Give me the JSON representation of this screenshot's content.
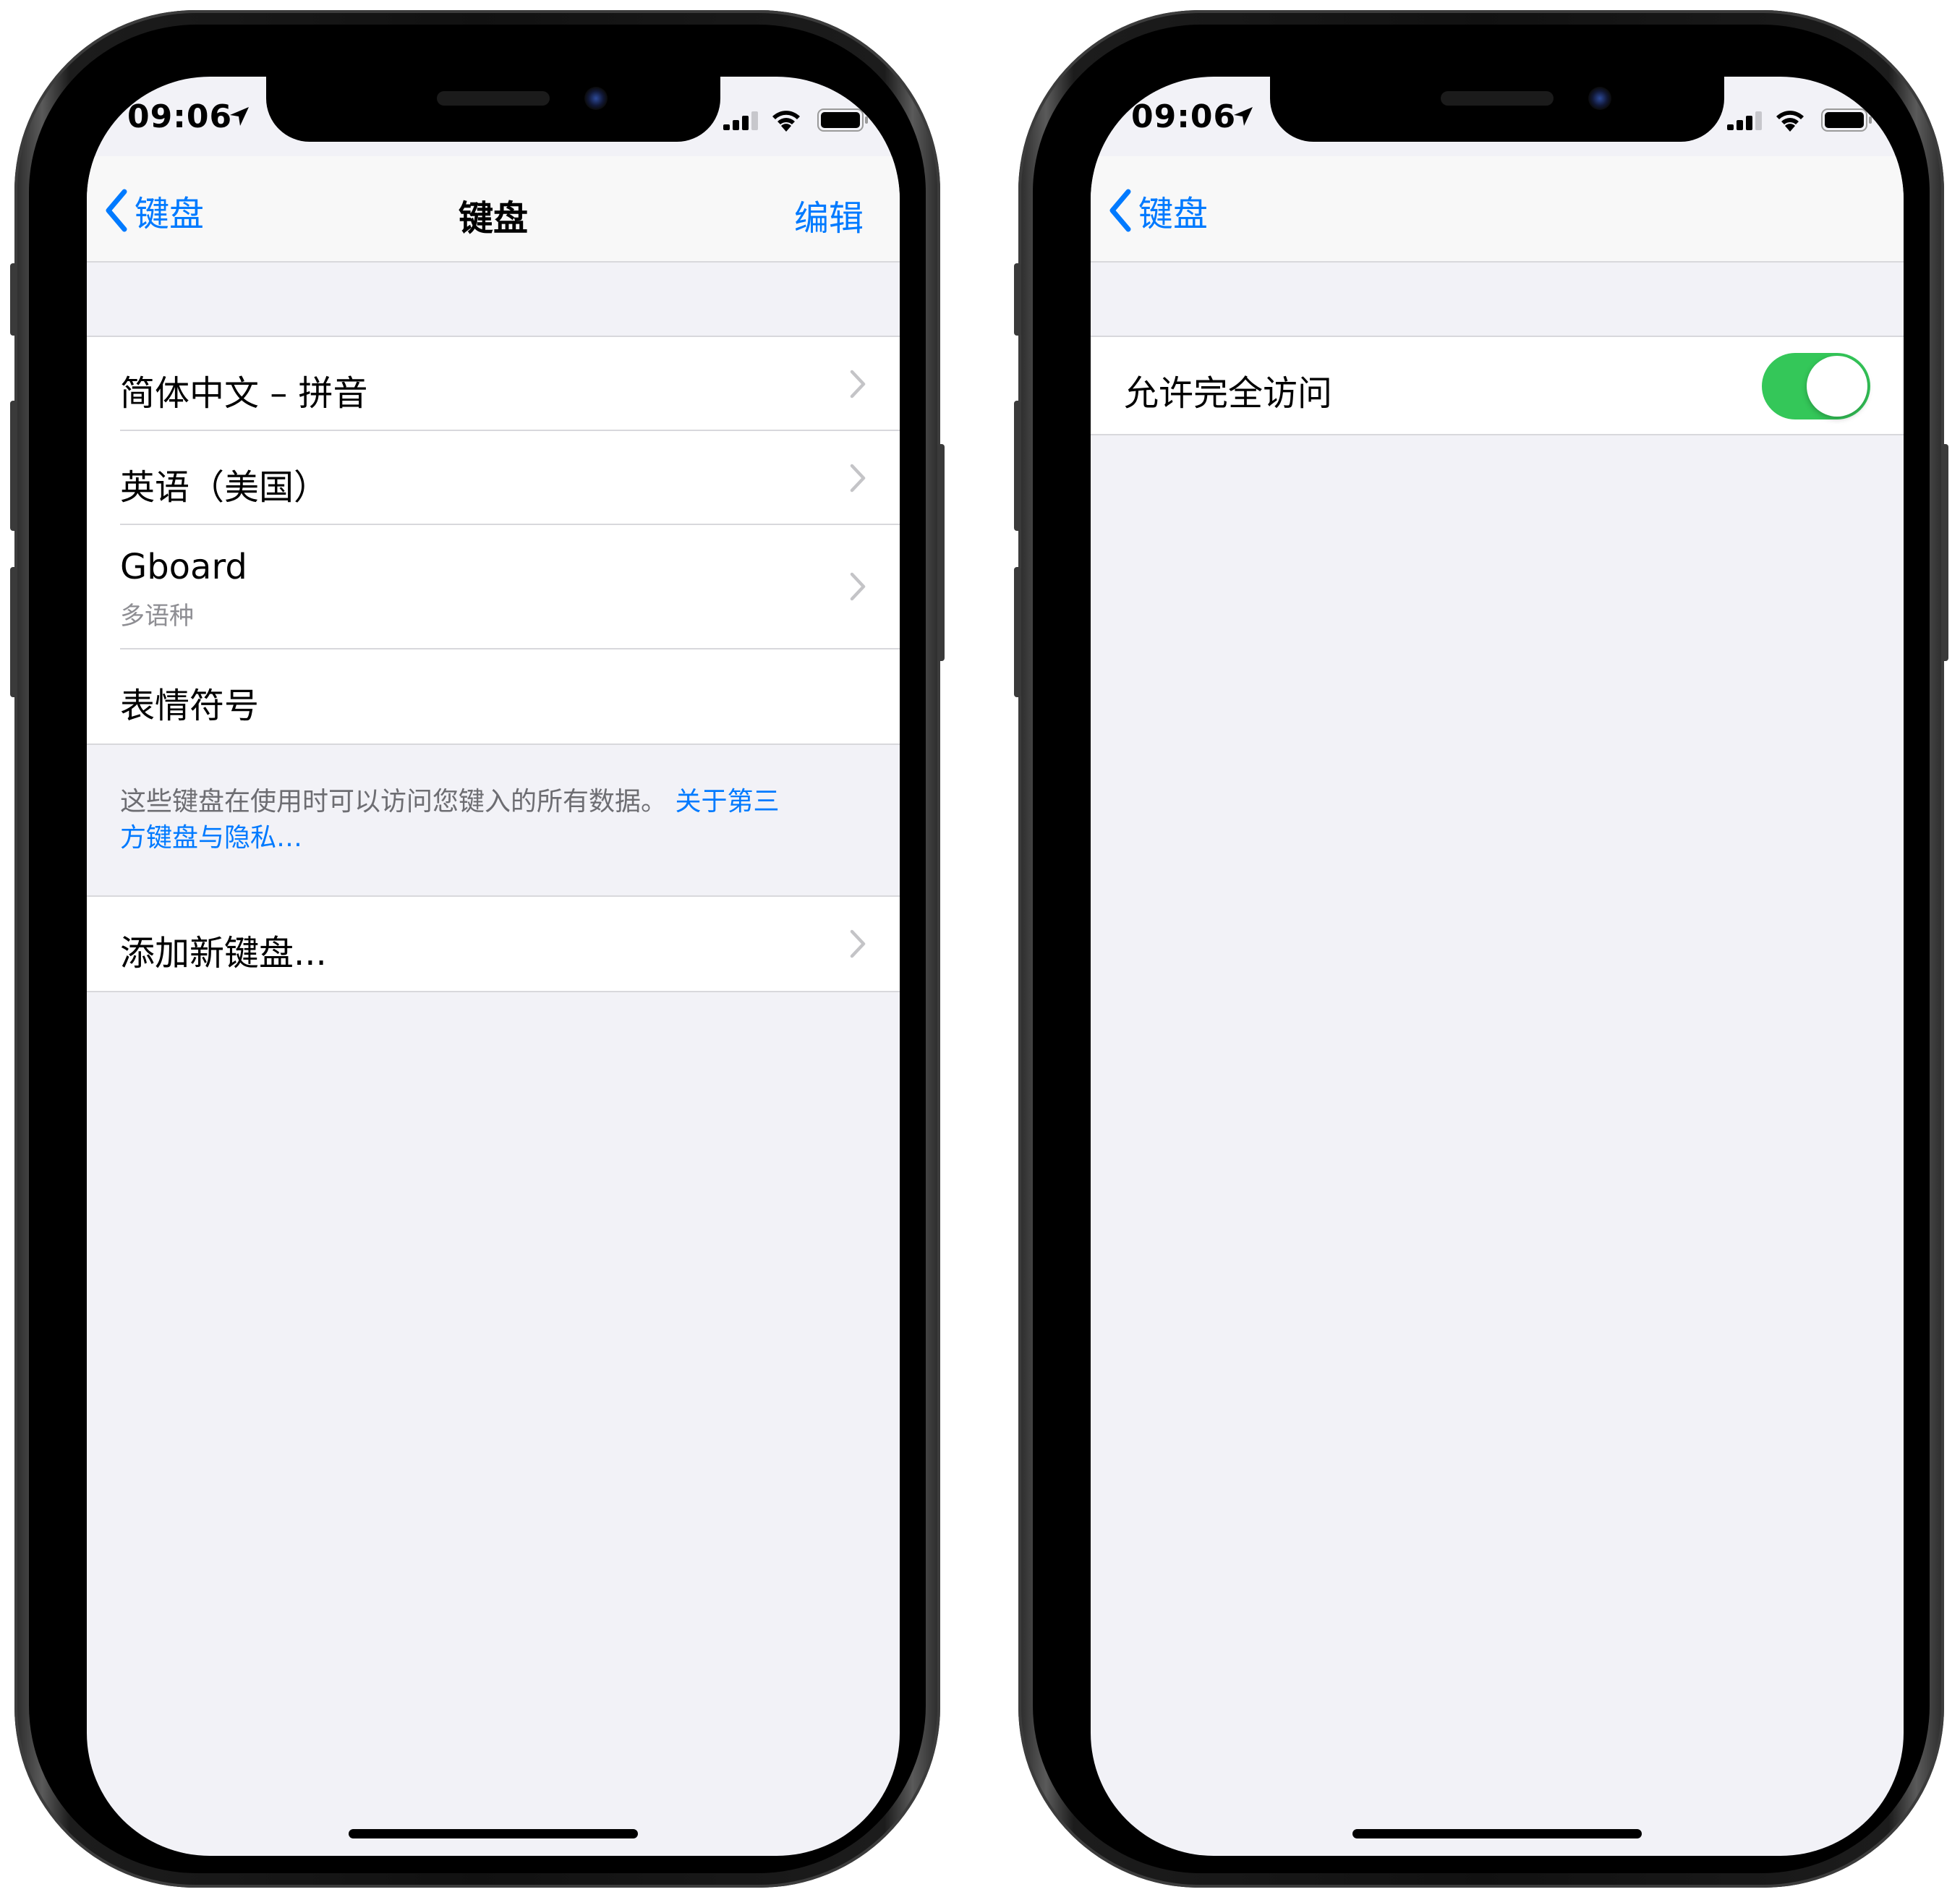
{
  "status_bar": {
    "time": "09:06"
  },
  "left_screen": {
    "nav": {
      "back_label": "键盘",
      "title": "键盘",
      "edit_label": "编辑"
    },
    "keyboards": [
      {
        "label": "简体中文 – 拼音"
      },
      {
        "label": "英语（美国）"
      },
      {
        "label": "Gboard",
        "sublabel": "多语种"
      },
      {
        "label": "表情符号"
      }
    ],
    "footer": {
      "text": "这些键盘在使用时可以访问您键入的所有数据。",
      "link_part1": "关于第三",
      "link_part2": "方键盘与隐私…"
    },
    "add_keyboard": {
      "label": "添加新键盘..."
    }
  },
  "right_screen": {
    "nav": {
      "back_label": "键盘"
    },
    "full_access": {
      "label": "允许完全访问",
      "enabled": true
    }
  },
  "colors": {
    "accent": "#007aff",
    "toggle_on": "#34c759",
    "background": "#f2f2f7"
  }
}
